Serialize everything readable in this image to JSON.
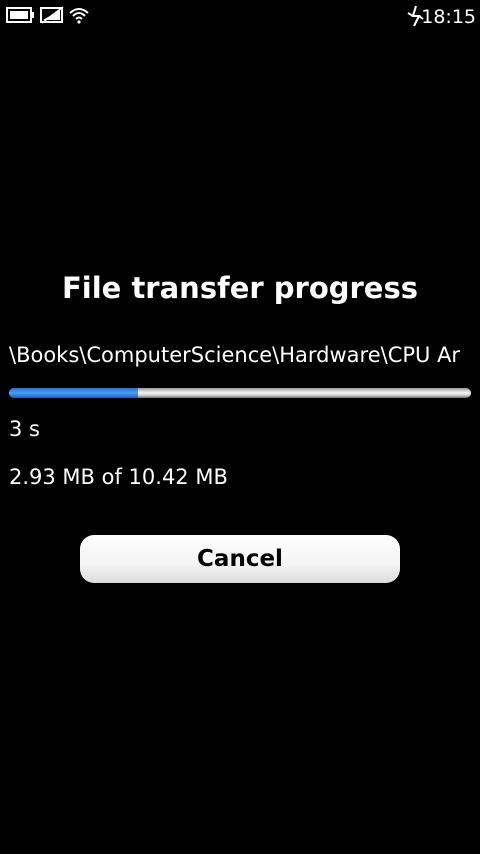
{
  "status_bar": {
    "icons": [
      "battery-icon",
      "network-icon",
      "wifi-icon",
      "usb-icon"
    ],
    "time": "18:15"
  },
  "dialog": {
    "title": "File transfer progress",
    "file_path": "\\Books\\ComputerScience\\Hardware\\CPU Ar",
    "progress_fraction": 0.28,
    "time_remaining": "3 s",
    "size_progress": "2.93 MB of 10.42 MB",
    "cancel_label": "Cancel"
  },
  "colors": {
    "background": "#000000",
    "text": "#ffffff",
    "progress_accent": "#2f80e8",
    "button_background": "#ffffff",
    "button_text": "#000000"
  }
}
